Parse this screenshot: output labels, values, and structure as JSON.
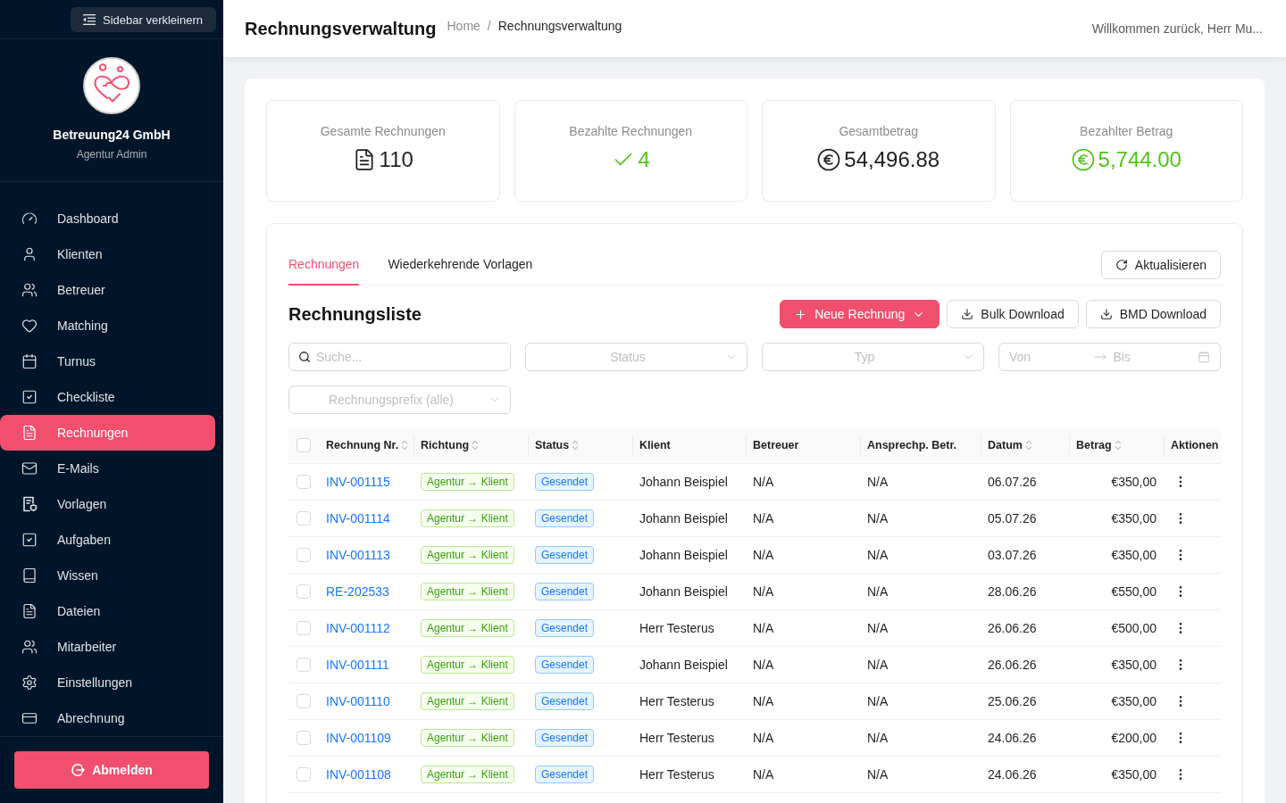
{
  "sidebar": {
    "collapse_button": "Sidebar verkleinern",
    "company_name": "Betreuung24 GmbH",
    "role": "Agentur Admin",
    "items": [
      {
        "label": "Dashboard",
        "selected": false
      },
      {
        "label": "Klienten",
        "selected": false
      },
      {
        "label": "Betreuer",
        "selected": false
      },
      {
        "label": "Matching",
        "selected": false
      },
      {
        "label": "Turnus",
        "selected": false
      },
      {
        "label": "Checkliste",
        "selected": false
      },
      {
        "label": "Rechnungen",
        "selected": true
      },
      {
        "label": "E-Mails",
        "selected": false
      },
      {
        "label": "Vorlagen",
        "selected": false
      },
      {
        "label": "Aufgaben",
        "selected": false
      },
      {
        "label": "Wissen",
        "selected": false
      },
      {
        "label": "Dateien",
        "selected": false
      },
      {
        "label": "Mitarbeiter",
        "selected": false
      },
      {
        "label": "Einstellungen",
        "selected": false
      },
      {
        "label": "Abrechnung",
        "selected": false
      }
    ],
    "logout_button": "Abmelden"
  },
  "header": {
    "title": "Rechnungsverwaltung",
    "breadcrumb": {
      "items": [
        {
          "label": "Home",
          "current": false
        },
        {
          "label": "Rechnungsverwaltung",
          "current": true
        }
      ],
      "separator": "/"
    },
    "welcome": "Willkommen zurück, Herr Mu..."
  },
  "stats": [
    {
      "label": "Gesamte Rechnungen",
      "value": "110",
      "color": "#1f1f1f"
    },
    {
      "label": "Bezahlte Rechnungen",
      "value": "4",
      "color": "#52c41a"
    },
    {
      "label": "Gesamtbetrag",
      "value": "54,496.88",
      "color": "#1f1f1f"
    },
    {
      "label": "Bezahlter Betrag",
      "value": "5,744.00",
      "color": "#52c41a"
    }
  ],
  "tabs": {
    "items": [
      {
        "label": "Rechnungen",
        "selected": true
      },
      {
        "label": "Wiederkehrende Vorlagen",
        "selected": false
      }
    ],
    "refresh_button": "Aktualisieren"
  },
  "invoice_list": {
    "title": "Rechnungsliste",
    "new_button": "Neue Rechnung",
    "bulk_download_button": "Bulk Download",
    "bmd_download_button": "BMD Download"
  },
  "filters": {
    "search": {
      "placeholder": "Suche..."
    },
    "status": {
      "placeholder": "Status"
    },
    "type": {
      "placeholder": "Typ"
    },
    "date_range": {
      "from_placeholder": "Von",
      "to_placeholder": "Bis"
    },
    "prefix": {
      "placeholder": "Rechnungsprefix (alle)"
    }
  },
  "table": {
    "select_all": {
      "checked": false
    },
    "columns": [
      {
        "label": "Rechnung Nr.",
        "sortable": true
      },
      {
        "label": "Richtung",
        "sortable": true
      },
      {
        "label": "Status",
        "sortable": true
      },
      {
        "label": "Klient",
        "sortable": false
      },
      {
        "label": "Betreuer",
        "sortable": false
      },
      {
        "label": "Ansprechp. Betr.",
        "sortable": false
      },
      {
        "label": "Datum",
        "sortable": true
      },
      {
        "label": "Betrag",
        "sortable": true
      },
      {
        "label": "Aktionen",
        "sortable": false
      }
    ],
    "rows": [
      {
        "checked": false,
        "number": "INV-001115",
        "direction": "Agentur → Klient",
        "status": "Gesendet",
        "client": "Johann Beispiel",
        "caregiver": "N/A",
        "contact_person": "N/A",
        "date": "06.07.26",
        "amount": "€350,00"
      },
      {
        "checked": false,
        "number": "INV-001114",
        "direction": "Agentur → Klient",
        "status": "Gesendet",
        "client": "Johann Beispiel",
        "caregiver": "N/A",
        "contact_person": "N/A",
        "date": "05.07.26",
        "amount": "€350,00"
      },
      {
        "checked": false,
        "number": "INV-001113",
        "direction": "Agentur → Klient",
        "status": "Gesendet",
        "client": "Johann Beispiel",
        "caregiver": "N/A",
        "contact_person": "N/A",
        "date": "03.07.26",
        "amount": "€350,00"
      },
      {
        "checked": false,
        "number": "RE-202533",
        "direction": "Agentur → Klient",
        "status": "Gesendet",
        "client": "Johann Beispiel",
        "caregiver": "N/A",
        "contact_person": "N/A",
        "date": "28.06.26",
        "amount": "€550,00"
      },
      {
        "checked": false,
        "number": "INV-001112",
        "direction": "Agentur → Klient",
        "status": "Gesendet",
        "client": "Herr Testerus",
        "caregiver": "N/A",
        "contact_person": "N/A",
        "date": "26.06.26",
        "amount": "€500,00"
      },
      {
        "checked": false,
        "number": "INV-001111",
        "direction": "Agentur → Klient",
        "status": "Gesendet",
        "client": "Johann Beispiel",
        "caregiver": "N/A",
        "contact_person": "N/A",
        "date": "26.06.26",
        "amount": "€350,00"
      },
      {
        "checked": false,
        "number": "INV-001110",
        "direction": "Agentur → Klient",
        "status": "Gesendet",
        "client": "Herr Testerus",
        "caregiver": "N/A",
        "contact_person": "N/A",
        "date": "25.06.26",
        "amount": "€350,00"
      },
      {
        "checked": false,
        "number": "INV-001109",
        "direction": "Agentur → Klient",
        "status": "Gesendet",
        "client": "Herr Testerus",
        "caregiver": "N/A",
        "contact_person": "N/A",
        "date": "24.06.26",
        "amount": "€200,00"
      },
      {
        "checked": false,
        "number": "INV-001108",
        "direction": "Agentur → Klient",
        "status": "Gesendet",
        "client": "Herr Testerus",
        "caregiver": "N/A",
        "contact_person": "N/A",
        "date": "24.06.26",
        "amount": "€350,00"
      }
    ]
  }
}
